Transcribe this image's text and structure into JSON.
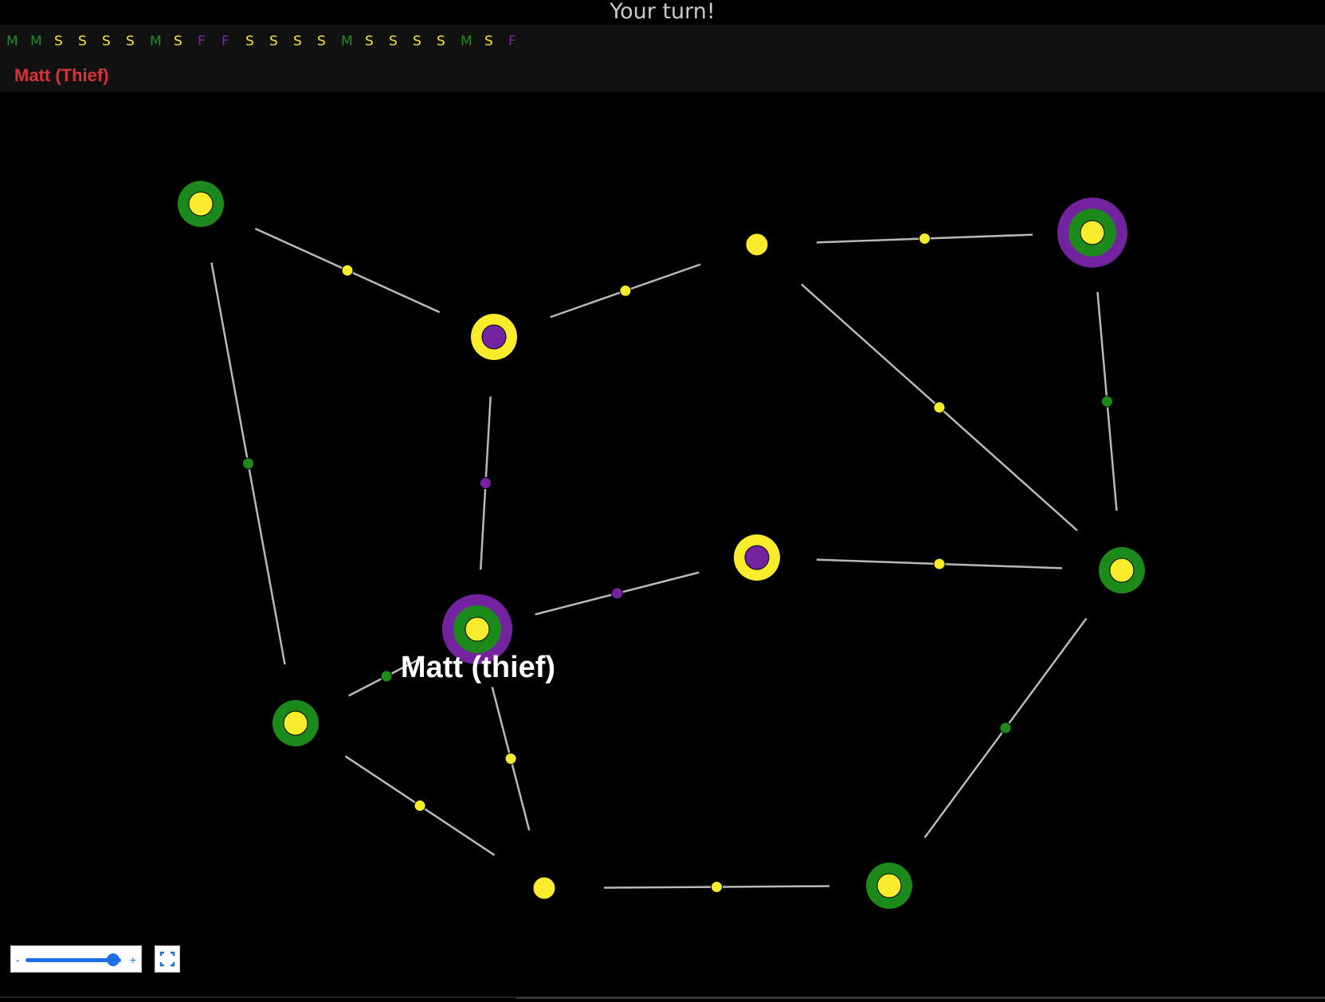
{
  "status": {
    "turn_text": "Your turn!"
  },
  "hand": {
    "cards": [
      "M",
      "M",
      "S",
      "S",
      "S",
      "S",
      "M",
      "S",
      "F",
      "F",
      "S",
      "S",
      "S",
      "S",
      "M",
      "S",
      "S",
      "S",
      "S",
      "M",
      "S",
      "F"
    ],
    "colors": {
      "M": "#1e8a1e",
      "S": "#f4e731",
      "F": "#7a2aa0"
    }
  },
  "player": {
    "name_label": "Matt (Thief)",
    "name_color": "#d8323a",
    "board_label": "Matt (thief)"
  },
  "board": {
    "colors": {
      "yellow": "#f9ec2d",
      "green": "#1b8a1b",
      "purple": "#7423a0",
      "edge": "#b9b9b9"
    },
    "nodes": [
      {
        "id": "n1",
        "rings": [
          "green",
          "yellow"
        ]
      },
      {
        "id": "n2",
        "rings": [
          "yellow",
          "purple"
        ]
      },
      {
        "id": "n3",
        "rings": [
          "yellow"
        ]
      },
      {
        "id": "n4",
        "rings": [
          "purple",
          "green",
          "yellow"
        ]
      },
      {
        "id": "n5",
        "rings": [
          "yellow",
          "purple"
        ]
      },
      {
        "id": "n6",
        "rings": [
          "green",
          "yellow"
        ]
      },
      {
        "id": "n7",
        "rings": [
          "purple",
          "green",
          "yellow"
        ]
      },
      {
        "id": "n8",
        "rings": [
          "green",
          "yellow"
        ]
      },
      {
        "id": "n9",
        "rings": [
          "yellow"
        ]
      },
      {
        "id": "n10",
        "rings": [
          "green",
          "yellow"
        ]
      }
    ],
    "edges": [
      {
        "from": "n1",
        "to": "n2",
        "marker": "yellow"
      },
      {
        "from": "n2",
        "to": "n3",
        "marker": "yellow"
      },
      {
        "from": "n3",
        "to": "n4",
        "marker": "yellow"
      },
      {
        "from": "n1",
        "to": "n8",
        "marker": "green"
      },
      {
        "from": "n2",
        "to": "n7",
        "marker": "purple"
      },
      {
        "from": "n3",
        "to": "n6",
        "marker": "yellow"
      },
      {
        "from": "n4",
        "to": "n6",
        "marker": "green"
      },
      {
        "from": "n7",
        "to": "n5",
        "marker": "purple"
      },
      {
        "from": "n5",
        "to": "n6",
        "marker": "yellow"
      },
      {
        "from": "n8",
        "to": "n7",
        "marker": "green"
      },
      {
        "from": "n7",
        "to": "n9",
        "marker": "yellow"
      },
      {
        "from": "n8",
        "to": "n9",
        "marker": "yellow"
      },
      {
        "from": "n9",
        "to": "n10",
        "marker": "yellow"
      },
      {
        "from": "n6",
        "to": "n10",
        "marker": "green"
      }
    ]
  },
  "controls": {
    "zoom_minus": "-",
    "zoom_plus": "+",
    "zoom_level": 0.92,
    "fullscreen_icon": "fullscreen-icon"
  }
}
